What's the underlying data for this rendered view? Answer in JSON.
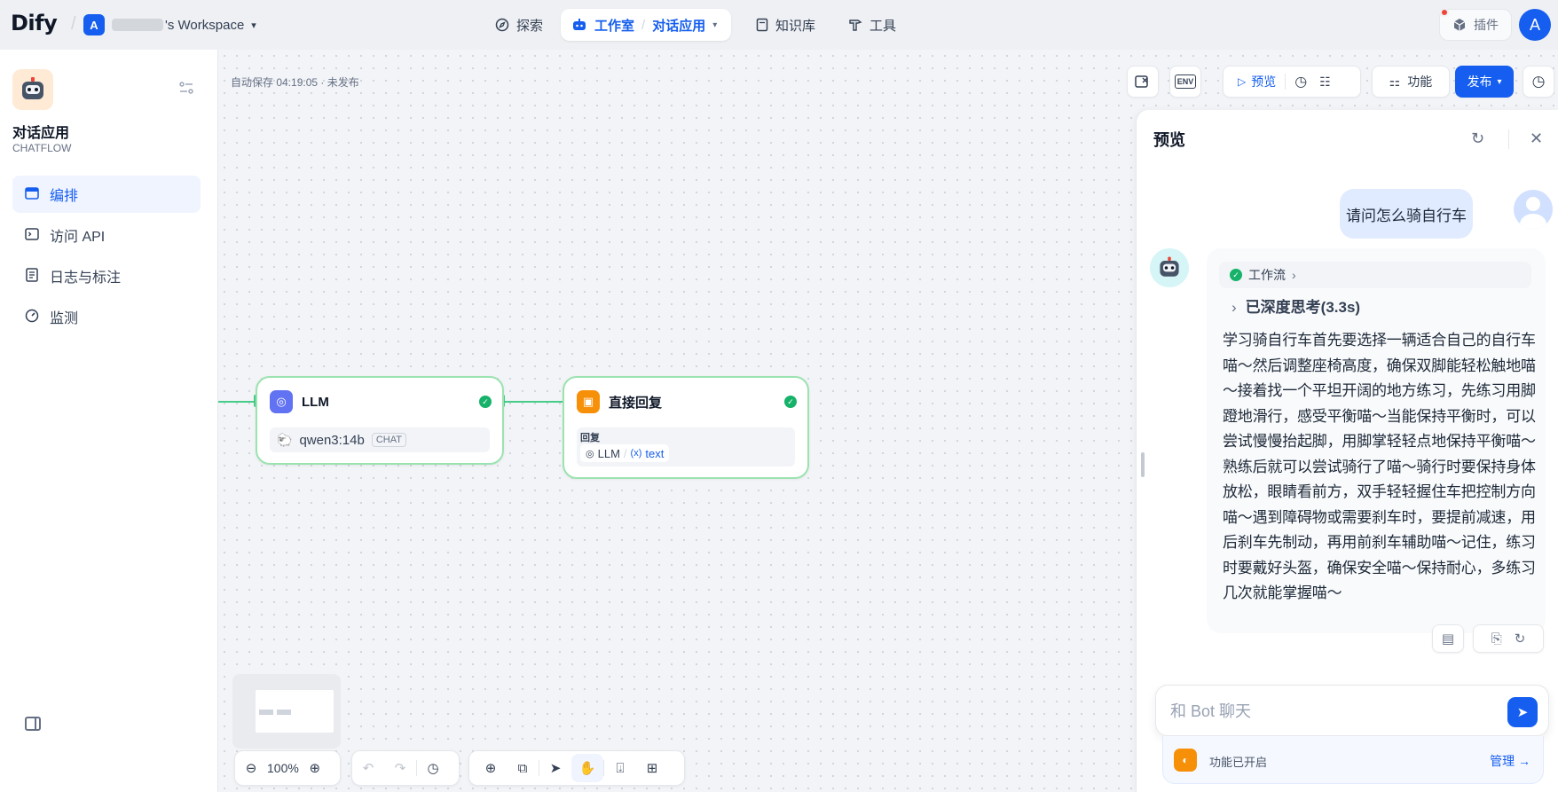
{
  "header": {
    "logo": "Dify",
    "workspace_initial": "A",
    "workspace_name": "'s Workspace",
    "nav": {
      "explore": "探索",
      "studio": "工作室",
      "current_app": "对话应用",
      "knowledge": "知识库",
      "tools": "工具"
    },
    "plugins_label": "插件",
    "user_initial": "A"
  },
  "sidebar": {
    "app_name": "对话应用",
    "app_type": "CHATFLOW",
    "items": [
      {
        "label": "编排",
        "icon": "layout-icon",
        "active": true
      },
      {
        "label": "访问 API",
        "icon": "terminal-icon",
        "active": false
      },
      {
        "label": "日志与标注",
        "icon": "log-icon",
        "active": false
      },
      {
        "label": "监测",
        "icon": "monitor-icon",
        "active": false
      }
    ]
  },
  "canvas": {
    "autosave": "自动保存 04:19:05 · 未发布",
    "toolbar": {
      "env_label": "ENV",
      "preview_label": "预览",
      "features_label": "功能",
      "publish_label": "发布"
    },
    "nodes": {
      "llm": {
        "title": "LLM",
        "model": "qwen3:14b",
        "mode_tag": "CHAT"
      },
      "answer": {
        "title": "直接回复",
        "field_label": "回复",
        "var_source": "LLM",
        "var_sep": "/",
        "var_name": "text",
        "var_prefix": "(x)"
      }
    },
    "zoom": "100%"
  },
  "preview": {
    "title": "预览",
    "user_message": "请问怎么骑自行车",
    "workflow_label": "工作流",
    "thinking_label": "已深度思考(3.3s)",
    "bot_message": "学习骑自行车首先要选择一辆适合自己的自行车喵～然后调整座椅高度，确保双脚能轻松触地喵～接着找一个平坦开阔的地方练习，先练习用脚蹬地滑行，感受平衡喵～当能保持平衡时，可以尝试慢慢抬起脚，用脚掌轻轻点地保持平衡喵～熟练后就可以尝试骑行了喵～骑行时要保持身体放松，眼睛看前方，双手轻轻握住车把控制方向喵～遇到障碍物或需要刹车时，要提前减速，用后刹车先制动，再用前刹车辅助喵～记住，练习时要戴好头盔，确保安全喵～保持耐心，多练习几次就能掌握喵～",
    "input_placeholder": "和 Bot 聊天",
    "features_enabled": "功能已开启",
    "manage_label": "管理 →"
  },
  "colors": {
    "primary": "#155eef",
    "success": "#17b26a",
    "edge": "#47cd89",
    "answer_node": "#f79009",
    "llm_node": "#6172f3"
  }
}
